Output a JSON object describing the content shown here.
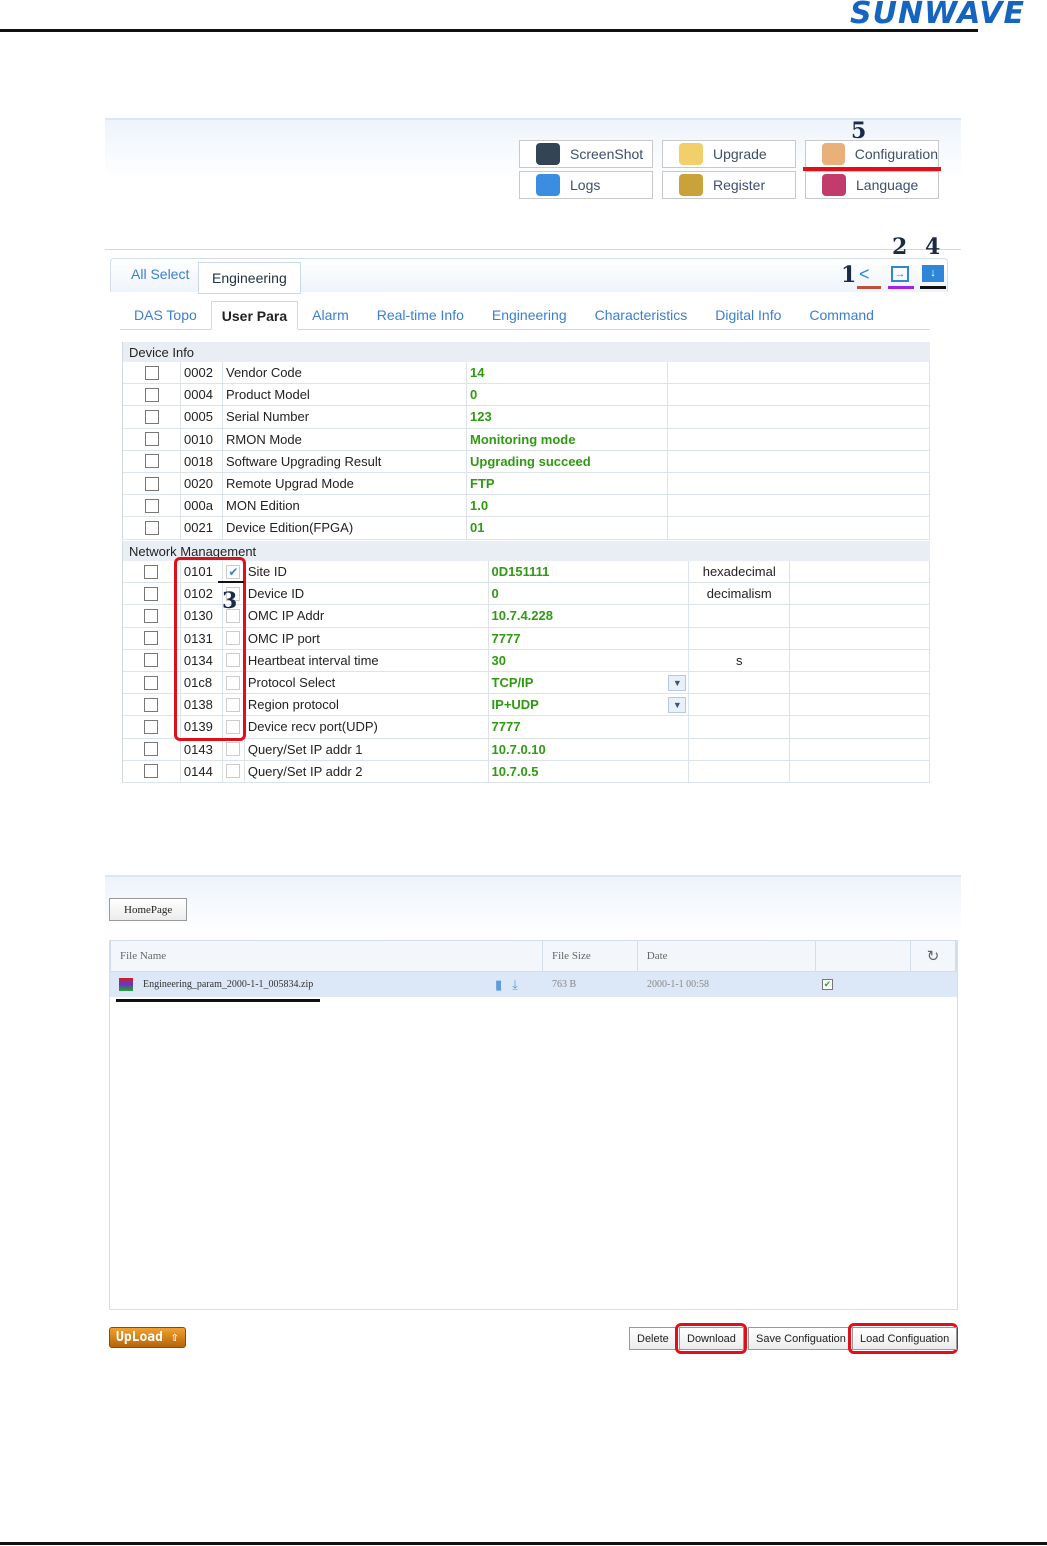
{
  "logo": "SUNWAVE",
  "toolbar": [
    {
      "label": "ScreenShot",
      "icon": "camera-icon"
    },
    {
      "label": "Upgrade",
      "icon": "folder-icon"
    },
    {
      "label": "Configuration",
      "icon": "palette-icon"
    },
    {
      "label": "Logs",
      "icon": "globe-clock-icon"
    },
    {
      "label": "Register",
      "icon": "lock-icon"
    },
    {
      "label": "Language",
      "icon": "language-icon"
    }
  ],
  "tabs": {
    "all_select": "All Select",
    "engineering": "Engineering"
  },
  "annotations": {
    "n1": "1",
    "n2": "2",
    "n3": "3",
    "n4": "4",
    "n5": "5"
  },
  "subtabs": [
    "DAS Topo",
    "User Para",
    "Alarm",
    "Real-time Info",
    "Engineering",
    "Characteristics",
    "Digital Info",
    "Command"
  ],
  "device_info": {
    "title": "Device Info",
    "rows": [
      [
        "0002",
        "Vendor Code",
        "14"
      ],
      [
        "0004",
        "Product Model",
        "0"
      ],
      [
        "0005",
        "Serial Number",
        "123"
      ],
      [
        "0010",
        "RMON Mode",
        "Monitoring mode"
      ],
      [
        "0018",
        "Software Upgrading Result",
        "Upgrading succeed"
      ],
      [
        "0020",
        "Remote Upgrad Mode",
        "FTP"
      ],
      [
        "000a",
        "MON Edition",
        "1.0"
      ],
      [
        "0021",
        "Device Edition(FPGA)",
        "01"
      ]
    ]
  },
  "network": {
    "title": "Network Management",
    "rows": [
      {
        "code": "0101",
        "name": "Site ID",
        "value": "0D151111",
        "unit": "hexadecimal",
        "checked": true
      },
      {
        "code": "0102",
        "name": "Device ID",
        "value": "0",
        "unit": "decimalism"
      },
      {
        "code": "0130",
        "name": "OMC IP Addr",
        "value": "10.7.4.228"
      },
      {
        "code": "0131",
        "name": "OMC IP port",
        "value": "7777"
      },
      {
        "code": "0134",
        "name": "Heartbeat interval time",
        "value": "30",
        "unit": "s"
      },
      {
        "code": "01c8",
        "name": "Protocol Select",
        "value": "TCP/IP",
        "select": true
      },
      {
        "code": "0138",
        "name": "Region protocol",
        "value": "IP+UDP",
        "select": true
      },
      {
        "code": "0139",
        "name": "Device recv port(UDP)",
        "value": "7777"
      },
      {
        "code": "0143",
        "name": "Query/Set IP addr 1",
        "value": "10.7.0.10"
      },
      {
        "code": "0144",
        "name": "Query/Set IP addr 2",
        "value": "10.7.0.5"
      }
    ]
  },
  "files": {
    "homepage": "HomePage",
    "headers": [
      "File Name",
      "File Size",
      "Date"
    ],
    "rows": [
      {
        "name": "Engineering_param_2000-1-1_005834.zip",
        "size": "763 B",
        "date": "2000-1-1 00:58",
        "checked": true
      }
    ]
  },
  "buttons": {
    "upload": "UpLoad",
    "delete": "Delete",
    "download": "Download",
    "save": "Save Configuation",
    "load": "Load Configuation"
  }
}
